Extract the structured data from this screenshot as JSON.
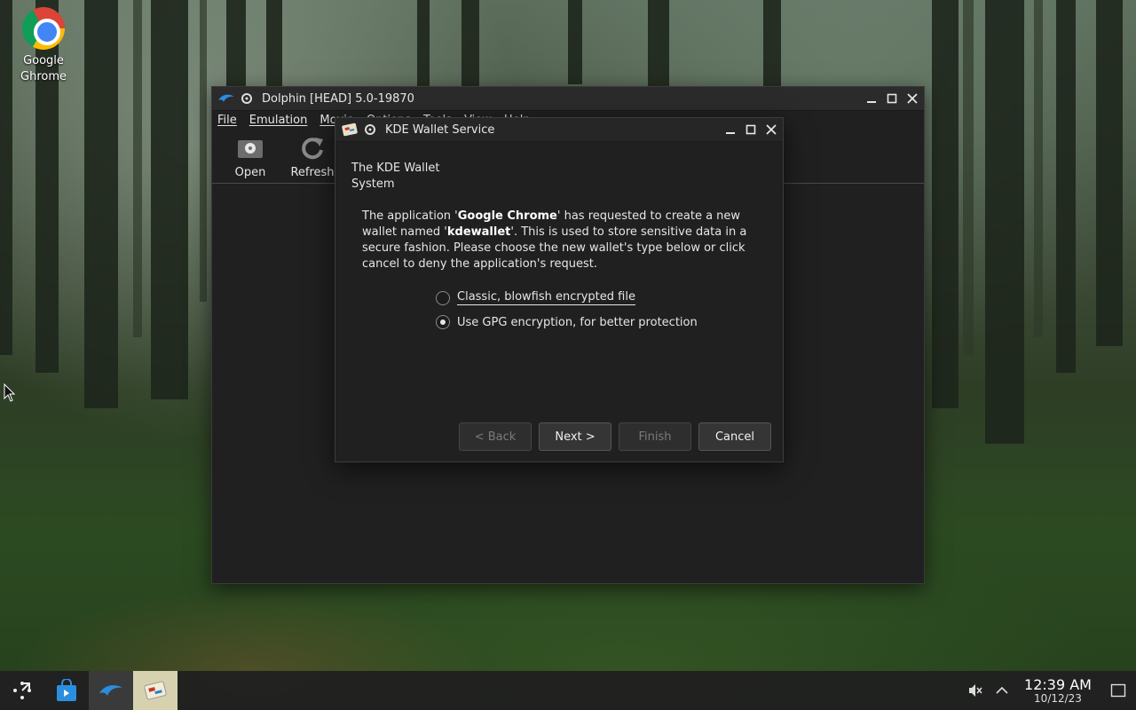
{
  "desktop": {
    "icons": [
      {
        "label": "Google\nGhrome",
        "icon": "chrome-icon"
      }
    ]
  },
  "dolphin": {
    "title": "Dolphin [HEAD] 5.0-19870",
    "menu": [
      "File",
      "Emulation",
      "Movie",
      "Options",
      "Tools",
      "View",
      "Help"
    ],
    "toolbar": [
      {
        "label": "Open",
        "icon": "open-disc-icon"
      },
      {
        "label": "Refresh",
        "icon": "refresh-icon"
      }
    ]
  },
  "wallet": {
    "title": "KDE Wallet Service",
    "header": "The KDE Wallet System",
    "body_pre": "The application '",
    "app_name": "Google Chrome",
    "body_mid": "' has requested to create a new wallet named '",
    "wallet_name": "kdewallet",
    "body_post": "'. This is used to store sensitive data in a secure fashion. Please choose the new wallet's type below or click cancel to deny the application's request.",
    "options": [
      {
        "label": "Classic, blowfish encrypted file",
        "selected": false
      },
      {
        "label": "Use GPG encryption, for better protection",
        "selected": true
      }
    ],
    "buttons": {
      "back": "< Back",
      "next": "Next >",
      "finish": "Finish",
      "cancel": "Cancel"
    }
  },
  "taskbar": {
    "apps": [
      "launcher-icon",
      "store-icon",
      "dolphin-icon",
      "wallet-icon"
    ],
    "clock": {
      "time": "12:39 AM",
      "date": "10/12/23"
    },
    "tray": [
      "muted-volume-icon",
      "chevron-up-icon",
      "desktop-icon"
    ]
  }
}
